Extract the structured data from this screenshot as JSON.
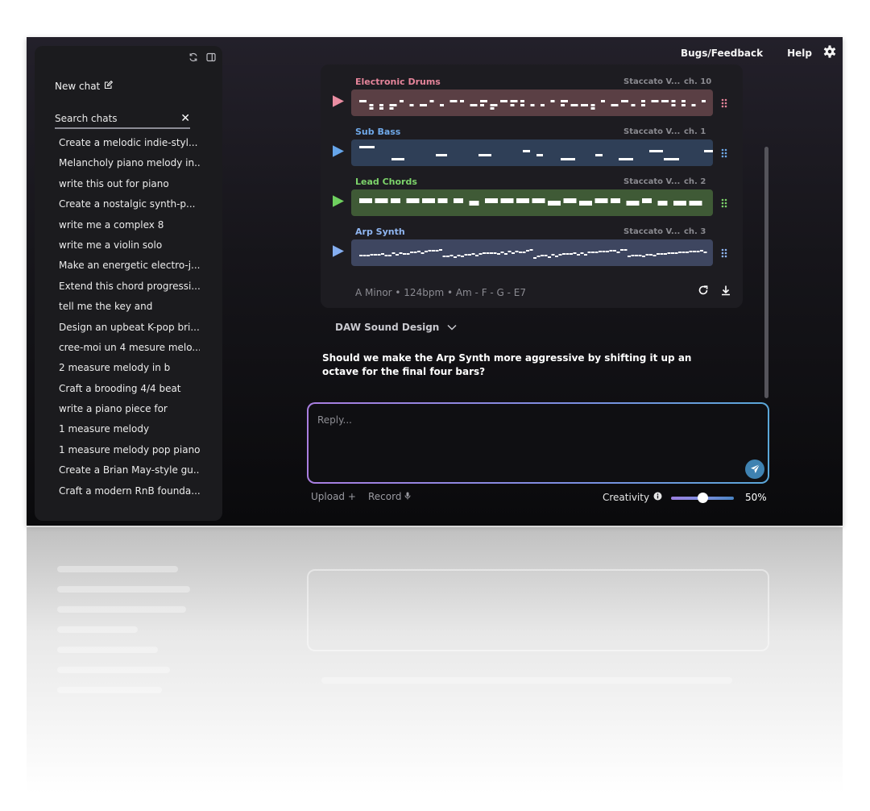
{
  "topnav": {
    "bugs_label": "Bugs/Feedback",
    "help_label": "Help",
    "settings_icon": "gear-icon"
  },
  "sidebar": {
    "new_chat_label": "New chat",
    "search_placeholder": "Search chats",
    "icons": [
      "refresh-icon",
      "panel-toggle-icon",
      "edit-icon",
      "close-icon"
    ],
    "chats": [
      "Create a melodic indie-styl...",
      "Melancholy piano melody in...",
      "write this out for piano",
      "Create a nostalgic synth-p...",
      "write me a complex 8",
      "write me a violin solo",
      "Make an energetic electro-j...",
      "Extend this chord progressi...",
      "tell me the key and",
      "Design an upbeat K-pop bri...",
      "cree-moi un 4 mesure melo...",
      "2 measure melody in b",
      "Craft a brooding 4/4 beat",
      "write a piano piece for",
      "1 measure melody",
      "1 measure melody pop piano",
      "Create a Brian May-style gu...",
      "Craft a modern RnB founda..."
    ]
  },
  "tracks": [
    {
      "name": "Electronic Drums",
      "instrument": "Staccato V...",
      "channel": "ch. 10",
      "color": "#e5849a",
      "lane_color": "#5a3f44",
      "play_color": "#e98da2"
    },
    {
      "name": "Sub Bass",
      "instrument": "Staccato V...",
      "channel": "ch. 1",
      "color": "#6fa8e8",
      "lane_color": "#2f3f57",
      "play_color": "#66a5ea"
    },
    {
      "name": "Lead Chords",
      "instrument": "Staccato V...",
      "channel": "ch. 2",
      "color": "#7cd36a",
      "lane_color": "#3f5a36",
      "play_color": "#6fd05f"
    },
    {
      "name": "Arp Synth",
      "instrument": "Staccato V...",
      "channel": "ch. 3",
      "color": "#8fb5f0",
      "lane_color": "#3e4660",
      "play_color": "#85aef0"
    }
  ],
  "song_meta": "A Minor • 124bpm • Am - F - G - E7",
  "daw_label": "DAW Sound Design",
  "question": "Should we make the Arp Synth more aggressive by shifting it up an octave for the final four bars?",
  "reply": {
    "placeholder": "Reply..."
  },
  "bottom": {
    "upload_label": "Upload +",
    "record_label": "Record",
    "creativity_label": "Creativity",
    "creativity_value": 0.5,
    "creativity_text": "50%"
  },
  "colors": {
    "accent_purple": "#a97ee0",
    "accent_blue": "#5aa7d8",
    "send_button": "#3f82b1"
  }
}
